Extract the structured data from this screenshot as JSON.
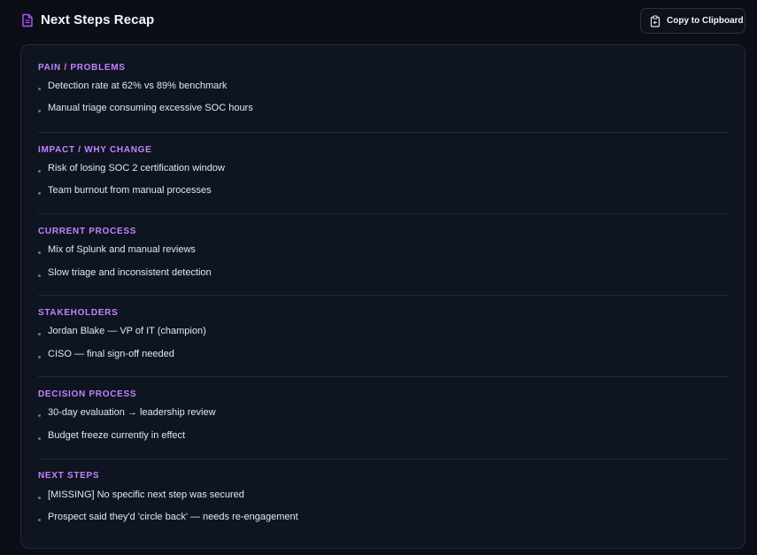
{
  "header": {
    "title": "Next Steps Recap",
    "copy_label": "Copy to Clipboard"
  },
  "sections": [
    {
      "title": "PAIN / PROBLEMS",
      "items": [
        "Detection rate at 62% vs 89% benchmark",
        "Manual triage consuming excessive SOC hours"
      ]
    },
    {
      "title": "IMPACT / WHY CHANGE",
      "items": [
        "Risk of losing SOC 2 certification window",
        "Team burnout from manual processes"
      ]
    },
    {
      "title": "CURRENT PROCESS",
      "items": [
        "Mix of Splunk and manual reviews",
        "Slow triage and inconsistent detection"
      ]
    },
    {
      "title": "STAKEHOLDERS",
      "items": [
        "Jordan Blake — VP of IT (champion)",
        "CISO — final sign-off needed"
      ]
    },
    {
      "title": "DECISION PROCESS",
      "items": [
        "30-day evaluation → leadership review",
        "Budget freeze currently in effect"
      ]
    },
    {
      "title": "NEXT STEPS",
      "items": [
        "[MISSING] No specific next step was secured",
        "Prospect said they'd 'circle back' — needs re-engagement"
      ]
    }
  ],
  "colors": {
    "accent": "#c084fc",
    "icon": "#a855f7",
    "background": "#0b0e17",
    "card": "#0f1421"
  },
  "icons": {
    "title": "document-icon",
    "copy": "clipboard-icon"
  }
}
